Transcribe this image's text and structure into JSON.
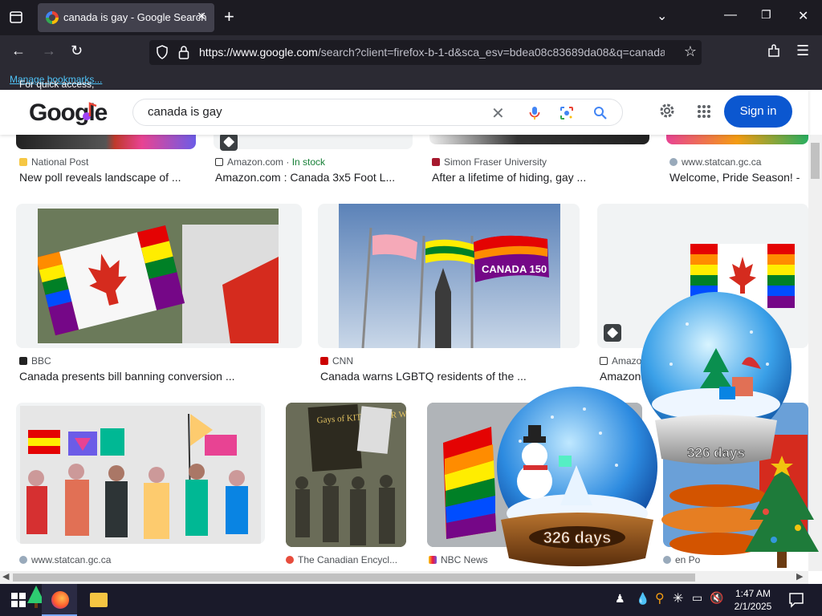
{
  "browser": {
    "tab_title": "canada is gay - Google Search",
    "url_host": "https://www.google.com",
    "url_rest": "/search?client=firefox-b-1-d&sca_esv=bdea08c83689da08&q=canada+i",
    "bookmarks_text": "For quick access, place your bookmarks here on the bookmarks toolbar.",
    "bookmarks_link": "Manage bookmarks..."
  },
  "google": {
    "logo": "Google",
    "query": "canada is gay",
    "sign_in": "Sign in"
  },
  "results": {
    "row1": [
      {
        "source": "National Post",
        "caption": "New poll reveals landscape of ..."
      },
      {
        "source": "Amazon.com",
        "stock": "In stock",
        "caption": "Amazon.com : Canada 3x5 Foot L..."
      },
      {
        "source": "Simon Fraser University",
        "caption": "After a lifetime of hiding, gay ..."
      },
      {
        "source": "www.statcan.gc.ca",
        "caption": "Welcome, Pride Season! -"
      }
    ],
    "row2": [
      {
        "source": "BBC",
        "caption": "Canada presents bill banning conversion ..."
      },
      {
        "source": "CNN",
        "caption": "Canada warns LGBTQ residents of the ..."
      },
      {
        "source": "Amazo",
        "caption": "Amazon"
      }
    ],
    "row3": [
      {
        "source": "www.statcan.gc.ca"
      },
      {
        "source": "The Canadian Encycl..."
      },
      {
        "source": "NBC News"
      },
      {
        "source": "en Po"
      }
    ],
    "image_banner_text": "CANADA 150",
    "protest_sign_text": "Gays of KITCHENER WATERLOO"
  },
  "widgets": {
    "globe_small_label": "326 days",
    "globe_large_label": "326 days"
  },
  "taskbar": {
    "time": "1:47 AM",
    "date": "2/1/2025"
  },
  "colors": {
    "accent": "#0b57d0",
    "chrome_dark": "#1c1b22",
    "link": "#4fc3f7"
  }
}
